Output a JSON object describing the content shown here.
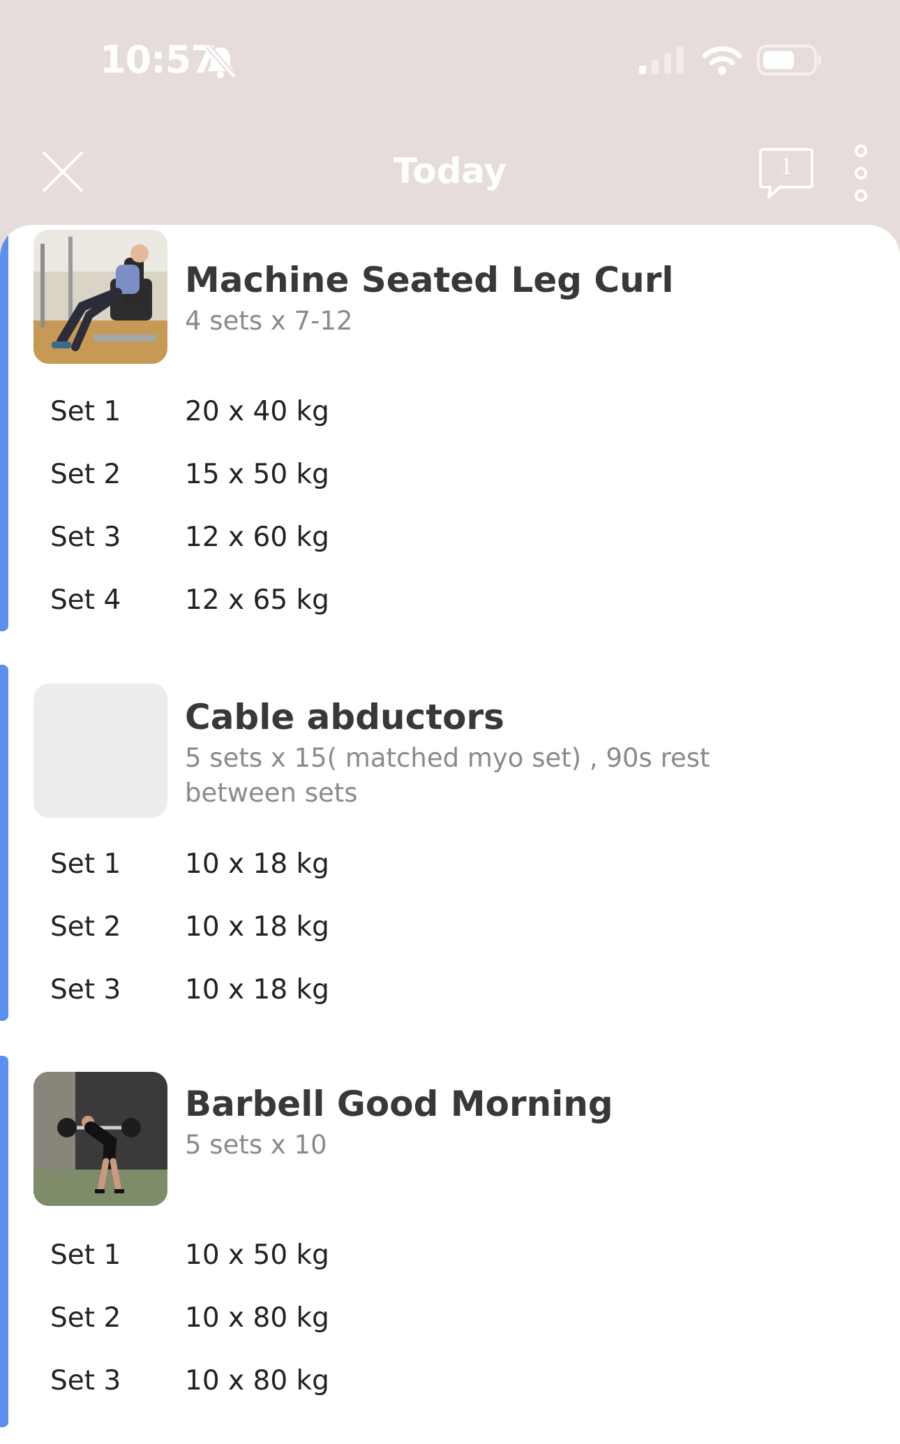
{
  "status_bar": {
    "time": "10:57",
    "icons": [
      "bell-slash-icon",
      "cellular-signal-icon",
      "wifi-icon",
      "battery-icon"
    ]
  },
  "nav": {
    "title": "Today",
    "comment_count": "1",
    "icons": [
      "close-icon",
      "comment-icon",
      "more-vertical-icon"
    ]
  },
  "colors": {
    "header_bg": "#e6dcda",
    "accent": "#5b8ff0",
    "sheet_bg": "#ffffff"
  },
  "exercises": [
    {
      "name": "Machine Seated Leg Curl",
      "prescription": "4 sets x 7-12",
      "sets": [
        {
          "label": "Set 1",
          "value": "20 x 40 kg"
        },
        {
          "label": "Set 2",
          "value": "15 x 50 kg"
        },
        {
          "label": "Set 3",
          "value": "12 x 60 kg"
        },
        {
          "label": "Set 4",
          "value": "12 x 65 kg"
        }
      ]
    },
    {
      "name": "Cable abductors",
      "prescription": "5 sets x 15( matched myo set) , 90s rest between sets",
      "sets": [
        {
          "label": "Set 1",
          "value": "10 x 18 kg"
        },
        {
          "label": "Set 2",
          "value": "10 x 18 kg"
        },
        {
          "label": "Set 3",
          "value": "10 x 18 kg"
        }
      ]
    },
    {
      "name": "Barbell Good Morning",
      "prescription": "5 sets x 10",
      "sets": [
        {
          "label": "Set 1",
          "value": "10 x 50 kg"
        },
        {
          "label": "Set 2",
          "value": "10 x 80 kg"
        },
        {
          "label": "Set 3",
          "value": "10 x 80 kg"
        }
      ]
    }
  ]
}
